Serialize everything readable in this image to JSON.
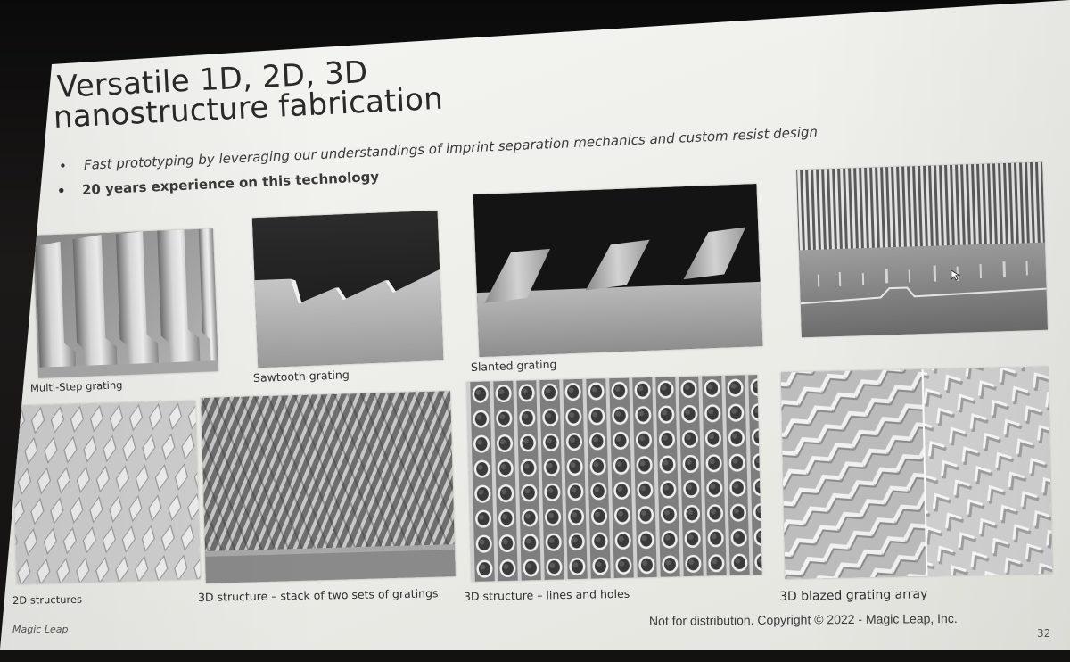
{
  "slide": {
    "title_line1": "Versatile 1D, 2D, 3D",
    "title_line2": "nanostructure fabrication",
    "bullets": [
      "Fast prototyping by leveraging our understandings of imprint separation mechanics and custom resist design",
      "20 years experience on this technology"
    ],
    "bullet_glyph": "•",
    "captions": [
      "Multi-Step grating",
      "Sawtooth grating",
      "Slanted grating",
      "2D structures",
      "3D structure – stack of two sets of gratings",
      "3D structure – lines and holes",
      "3D blazed grating array"
    ],
    "footer": {
      "brand": "Magic Leap",
      "copyright": "Not for distribution. Copyright © 2022 - Magic Leap, Inc.",
      "page_number": "32"
    }
  },
  "images": [
    {
      "name": "multi-step-grating-image"
    },
    {
      "name": "sawtooth-grating-image"
    },
    {
      "name": "slanted-grating-image"
    },
    {
      "name": "vertical-grating-image"
    },
    {
      "name": "2d-structures-image"
    },
    {
      "name": "stacked-gratings-image"
    },
    {
      "name": "lines-and-holes-image"
    },
    {
      "name": "blazed-grating-array-image"
    }
  ],
  "icons": {
    "cursor": "mouse-cursor-icon"
  },
  "colors": {
    "slide_bg": "#efefeb",
    "room_bg": "#121010",
    "text": "#2a2a2a"
  }
}
